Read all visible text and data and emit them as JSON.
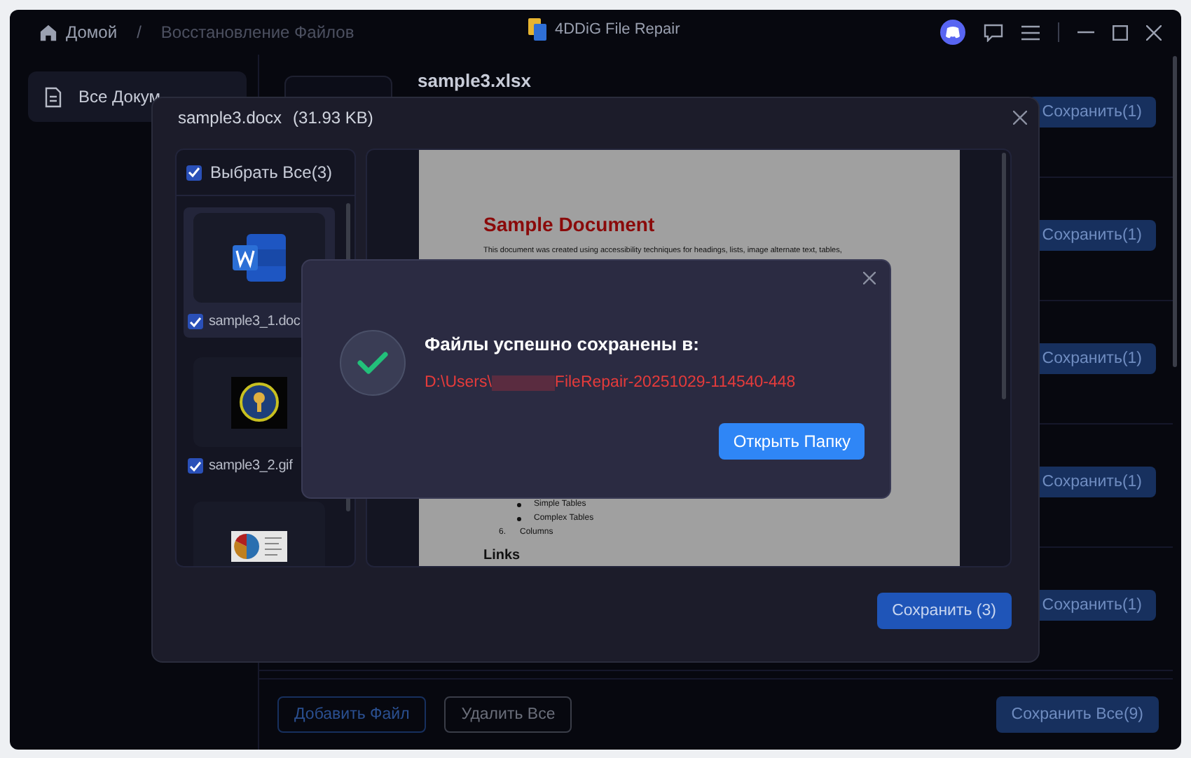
{
  "titlebar": {
    "breadcrumbs": [
      {
        "label": "Домой",
        "kind": "home"
      },
      {
        "label": "Восстановление Файлов",
        "kind": "current"
      }
    ],
    "separator": "/",
    "app_name": "4DDiG File Repair"
  },
  "sidebar": {
    "items": [
      {
        "label": "Все Докум",
        "selected": true
      }
    ]
  },
  "file_rows": [
    {
      "name": "sample3.xlsx",
      "save": "Сохранить(1)"
    },
    {
      "save": "Сохранить(1)"
    },
    {
      "save": "Сохранить(1)"
    },
    {
      "save": "Сохранить(1)"
    },
    {
      "save": "Сохранить(1)"
    }
  ],
  "bottom_bar": {
    "add": "Добавить Файл",
    "delete": "Удалить Все",
    "save_all": "Сохранить Все(9)"
  },
  "preview_modal": {
    "file_name": "sample3.docx",
    "file_size": "(31.93 KB)",
    "select_all": {
      "label": "Выбрать Все(3)",
      "checked": true
    },
    "files": [
      {
        "name": "sample3_1.doc",
        "kind": "word",
        "checked": true,
        "selected": true
      },
      {
        "name": "sample3_2.gif",
        "kind": "gif",
        "checked": true,
        "selected": false
      },
      {
        "kind": "chart",
        "selected": false
      }
    ],
    "document": {
      "title": "Sample Document",
      "intro": "This document was created using accessibility techniques for headings, lists, image alternate text, tables,",
      "bullets": [
        "Simple Tables",
        "Complex Tables"
      ],
      "numbered": [
        {
          "number": "6.",
          "text": "Columns"
        }
      ],
      "heading": "Links"
    },
    "save_button": "Сохранить (3)"
  },
  "success_dialog": {
    "title": "Файлы успешно сохранены в:",
    "path_start": "D:\\Users\\",
    "path_redacted": true,
    "path_end": "FileRepair-20251029-114540-448",
    "button": "Открыть Папку"
  }
}
